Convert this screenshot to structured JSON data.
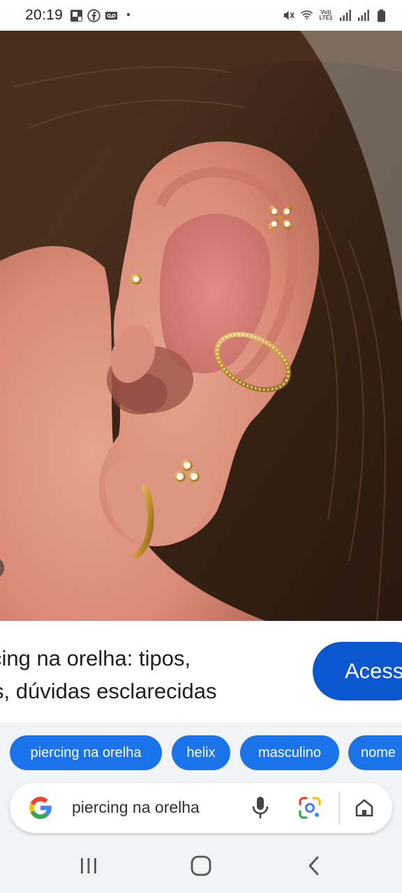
{
  "status_bar": {
    "time": "20:19",
    "left_icons": [
      "message-notification-icon",
      "facebook-icon",
      "voicemail-icon"
    ],
    "dot": "•",
    "right_icons": [
      "mute-icon",
      "wifi-icon",
      "volte-icon",
      "signal-icon",
      "signal-icon",
      "battery-icon"
    ],
    "volte_label": "Vo)) LTE1"
  },
  "image": {
    "subject": "ear with piercings photo",
    "accent": "#d4a24c"
  },
  "result": {
    "title_line1": "cing na orelha: tipos,",
    "title_line2": "s, dúvidas esclarecidas",
    "visit_label": "Acess"
  },
  "chips": [
    {
      "label": "piercing na orelha"
    },
    {
      "label": "helix"
    },
    {
      "label": "masculino"
    },
    {
      "label": "nome"
    }
  ],
  "search": {
    "query": "piercing na orelha",
    "brand_colors": {
      "blue": "#4285f4",
      "red": "#ea4335",
      "yellow": "#fbbc05",
      "green": "#34a853"
    }
  },
  "nav": {
    "buttons": [
      "recent-apps",
      "home",
      "back"
    ]
  },
  "colors": {
    "chip_bg": "#1a73e8",
    "visit_bg": "#0b57d0",
    "panel_bg": "#f1f3f4"
  }
}
